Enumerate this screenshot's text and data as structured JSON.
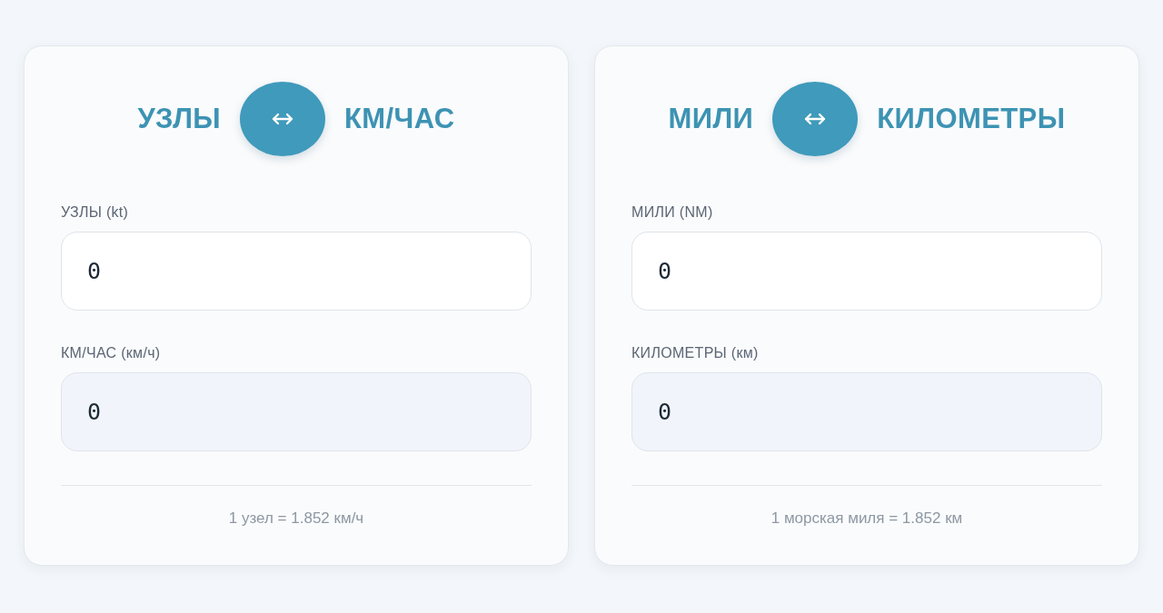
{
  "converters": [
    {
      "from_unit": "УЗЛЫ",
      "to_unit": "КМ/ЧАС",
      "fields": [
        {
          "kind": "input",
          "label": "УЗЛЫ (kt)",
          "value": "0"
        },
        {
          "kind": "result",
          "label": "КМ/ЧАС (км/ч)",
          "value": "0"
        }
      ],
      "note": "1 узел = 1.852 км/ч"
    },
    {
      "from_unit": "МИЛИ",
      "to_unit": "КИЛОМЕТРЫ",
      "fields": [
        {
          "kind": "input",
          "label": "МИЛИ (NM)",
          "value": "0"
        },
        {
          "kind": "result",
          "label": "КИЛОМЕТРЫ (км)",
          "value": "0"
        }
      ],
      "note": "1 морская миля = 1.852 км"
    }
  ]
}
